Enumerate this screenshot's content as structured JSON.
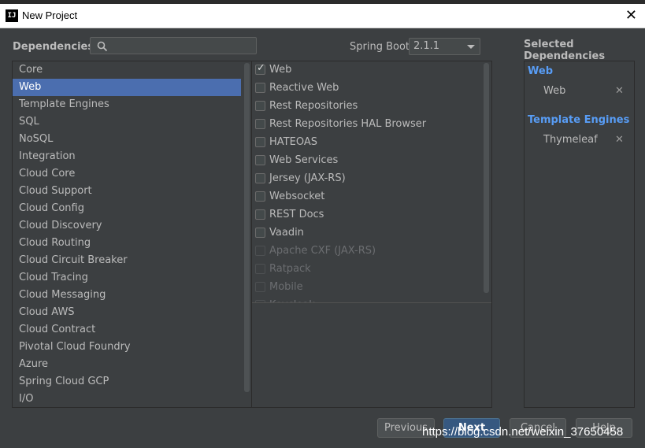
{
  "window": {
    "title": "New Project",
    "app_icon": "IJ"
  },
  "header": {
    "dependencies_label": "Dependencies",
    "spring_boot_label": "Spring Boot",
    "spring_boot_version": "2.1.1",
    "selected_label": "Selected Dependencies"
  },
  "categories": [
    {
      "label": "Core",
      "selected": false
    },
    {
      "label": "Web",
      "selected": true
    },
    {
      "label": "Template Engines",
      "selected": false
    },
    {
      "label": "SQL",
      "selected": false
    },
    {
      "label": "NoSQL",
      "selected": false
    },
    {
      "label": "Integration",
      "selected": false
    },
    {
      "label": "Cloud Core",
      "selected": false
    },
    {
      "label": "Cloud Support",
      "selected": false
    },
    {
      "label": "Cloud Config",
      "selected": false
    },
    {
      "label": "Cloud Discovery",
      "selected": false
    },
    {
      "label": "Cloud Routing",
      "selected": false
    },
    {
      "label": "Cloud Circuit Breaker",
      "selected": false
    },
    {
      "label": "Cloud Tracing",
      "selected": false
    },
    {
      "label": "Cloud Messaging",
      "selected": false
    },
    {
      "label": "Cloud AWS",
      "selected": false
    },
    {
      "label": "Cloud Contract",
      "selected": false
    },
    {
      "label": "Pivotal Cloud Foundry",
      "selected": false
    },
    {
      "label": "Azure",
      "selected": false
    },
    {
      "label": "Spring Cloud GCP",
      "selected": false
    },
    {
      "label": "I/O",
      "selected": false
    }
  ],
  "dependencies": [
    {
      "label": "Web",
      "checked": true,
      "enabled": true
    },
    {
      "label": "Reactive Web",
      "checked": false,
      "enabled": true
    },
    {
      "label": "Rest Repositories",
      "checked": false,
      "enabled": true
    },
    {
      "label": "Rest Repositories HAL Browser",
      "checked": false,
      "enabled": true
    },
    {
      "label": "HATEOAS",
      "checked": false,
      "enabled": true
    },
    {
      "label": "Web Services",
      "checked": false,
      "enabled": true
    },
    {
      "label": "Jersey (JAX-RS)",
      "checked": false,
      "enabled": true
    },
    {
      "label": "Websocket",
      "checked": false,
      "enabled": true
    },
    {
      "label": "REST Docs",
      "checked": false,
      "enabled": true
    },
    {
      "label": "Vaadin",
      "checked": false,
      "enabled": true
    },
    {
      "label": "Apache CXF (JAX-RS)",
      "checked": false,
      "enabled": false
    },
    {
      "label": "Ratpack",
      "checked": false,
      "enabled": false
    },
    {
      "label": "Mobile",
      "checked": false,
      "enabled": false
    },
    {
      "label": "Keycloak",
      "checked": false,
      "enabled": false
    }
  ],
  "selected": {
    "group1": "Web",
    "group1_item": "Web",
    "group2": "Template Engines",
    "group2_item": "Thymeleaf",
    "remove_glyph": "✕"
  },
  "buttons": {
    "previous": "Previous",
    "next": "Next",
    "cancel": "Cancel",
    "help": "Help"
  },
  "watermark": "https://blog.csdn.net/weixin_37650458"
}
